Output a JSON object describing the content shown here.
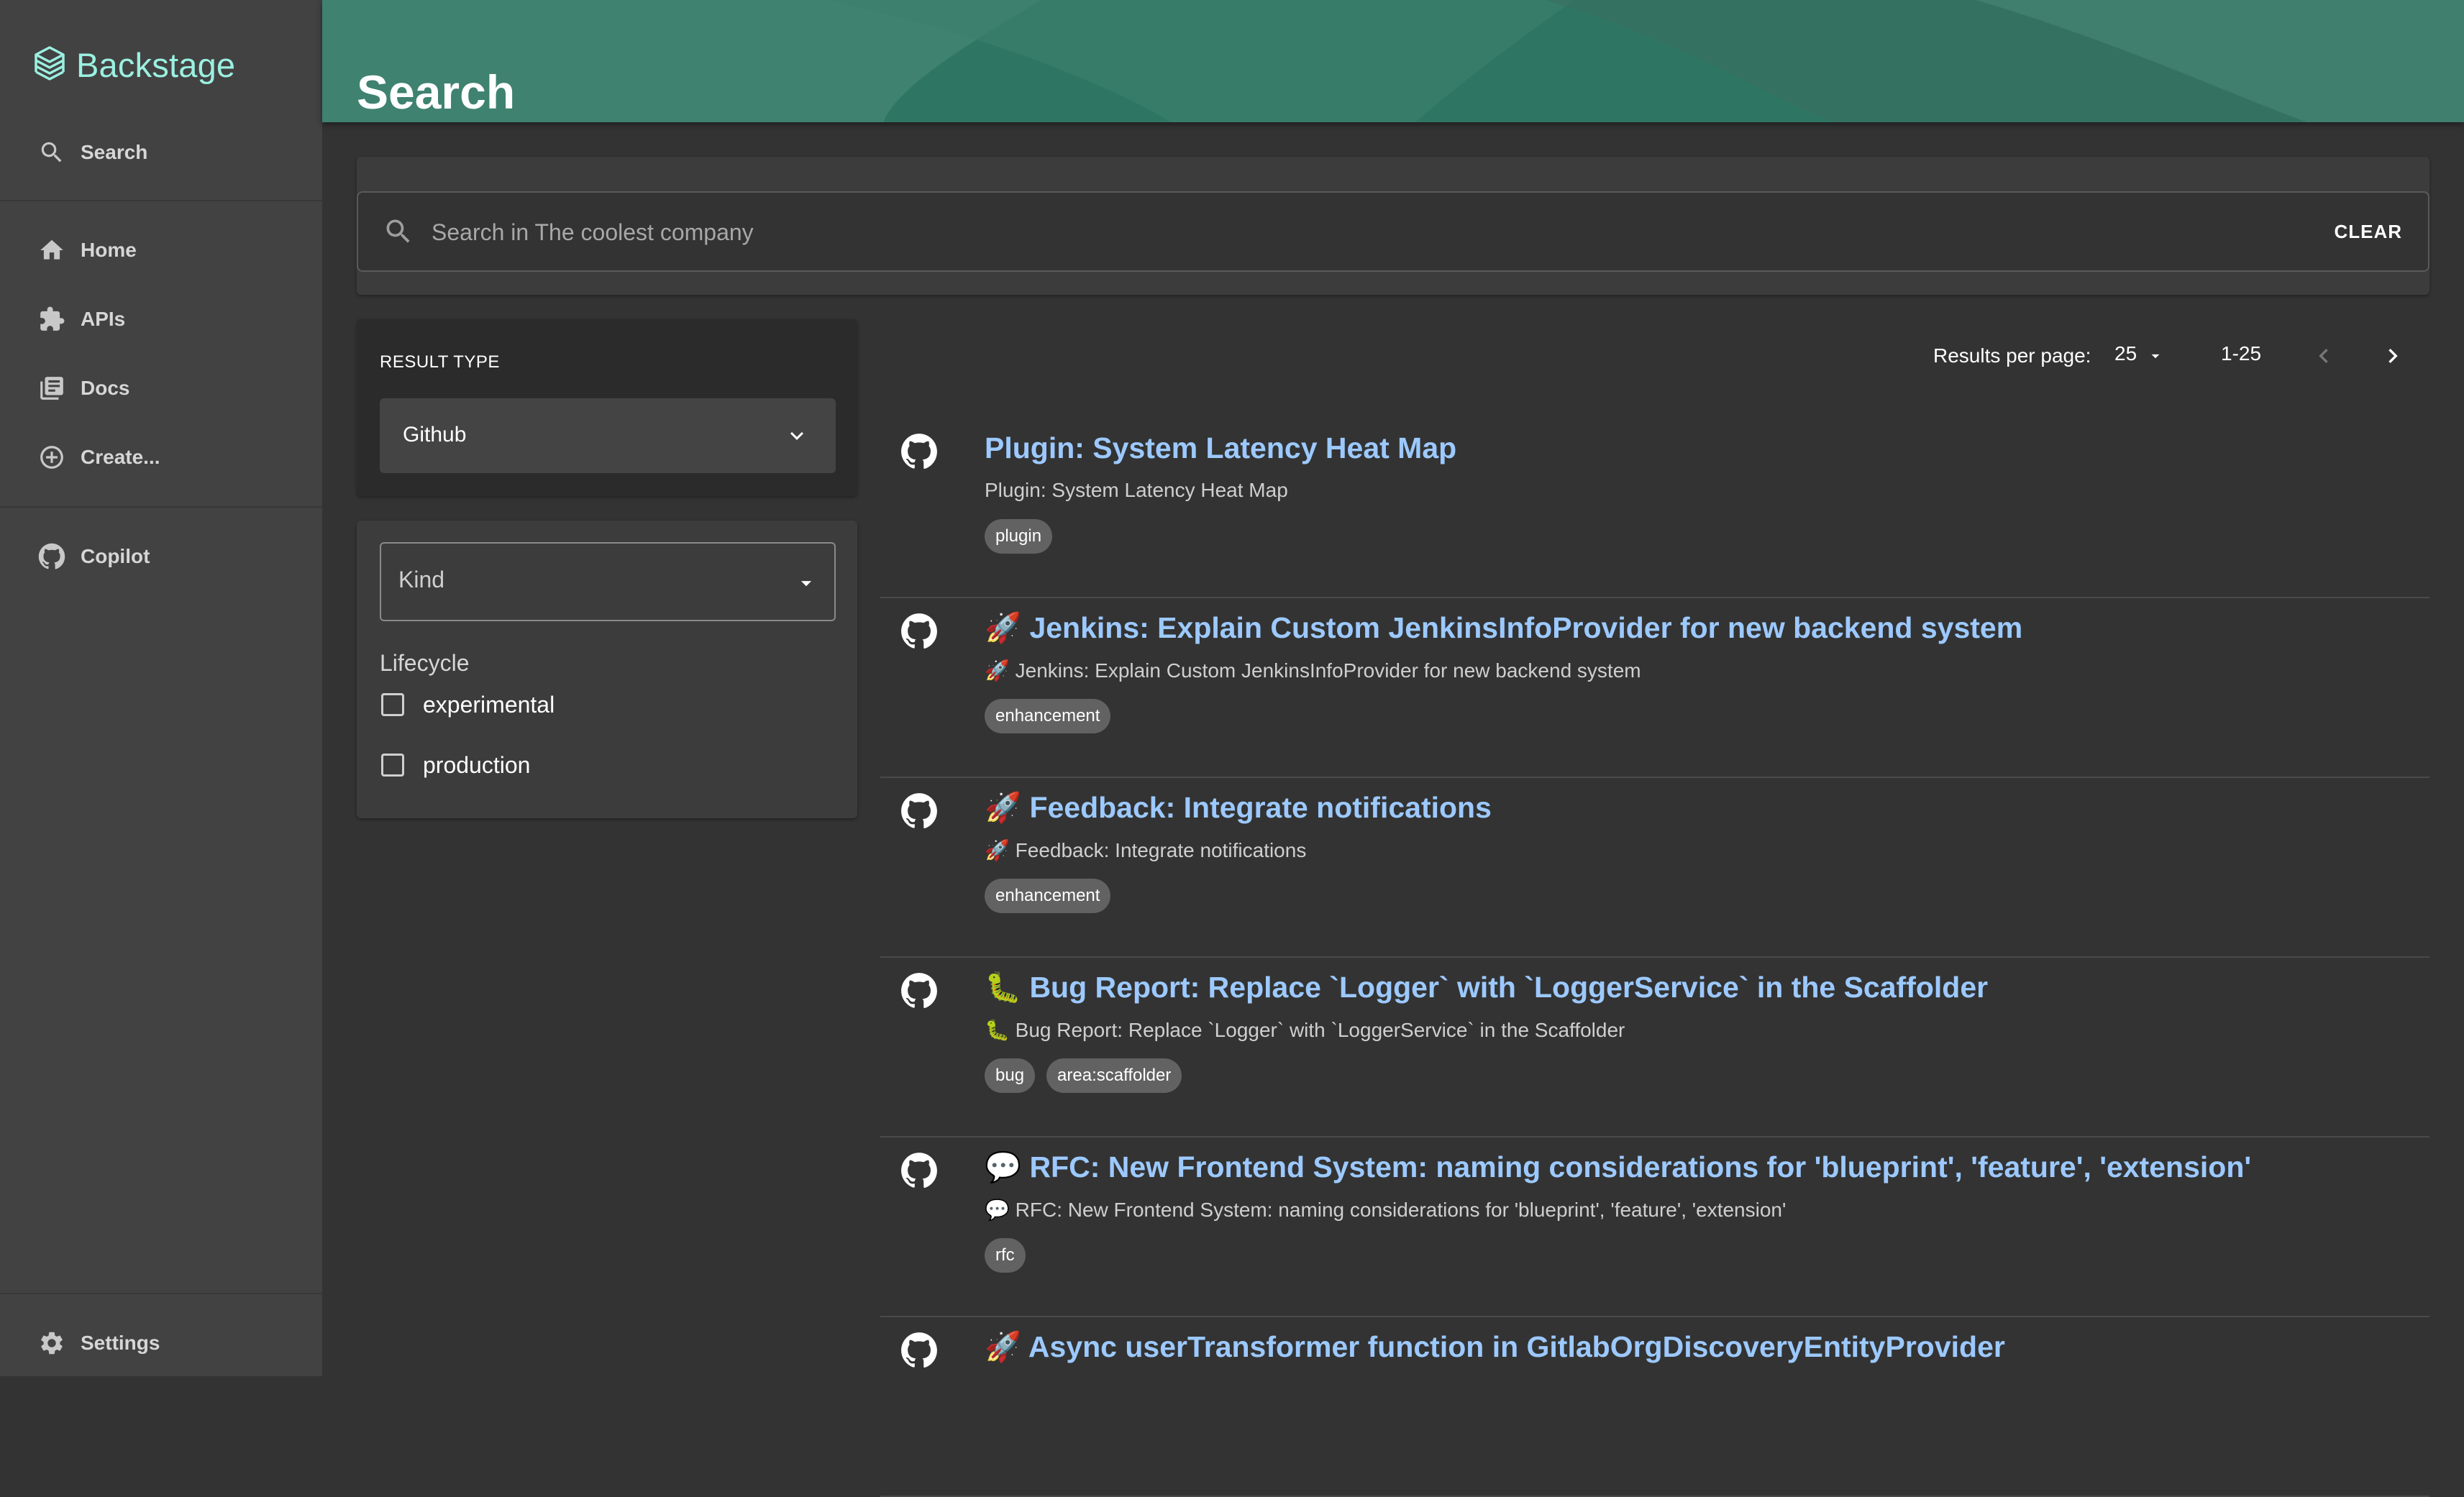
{
  "app": {
    "name": "Backstage",
    "colors": {
      "accent": "#9BF0E1",
      "link": "#9CC9FF",
      "header": "#2f7564",
      "sidebar": "#424242",
      "background": "#333333"
    }
  },
  "sidebar": {
    "search_label": "Search",
    "items": [
      {
        "label": "Home",
        "icon": "home-icon"
      },
      {
        "label": "APIs",
        "icon": "puzzle-icon"
      },
      {
        "label": "Docs",
        "icon": "library-books-icon"
      },
      {
        "label": "Create...",
        "icon": "add-circle-icon"
      }
    ],
    "copilot_label": "Copilot",
    "settings_label": "Settings"
  },
  "header": {
    "title": "Search"
  },
  "search": {
    "placeholder": "Search in The coolest company",
    "value": "",
    "clear_label": "CLEAR"
  },
  "filters": {
    "result_type_label": "RESULT TYPE",
    "result_type_value": "Github",
    "kind_label": "Kind",
    "lifecycle_label": "Lifecycle",
    "lifecycle_options": [
      "experimental",
      "production"
    ]
  },
  "pagination": {
    "results_per_page_label": "Results per page:",
    "results_per_page": "25",
    "range": "1-25"
  },
  "results": [
    {
      "title": "Plugin: System Latency Heat Map",
      "subtitle": "Plugin: System Latency Heat Map",
      "tags": [
        "plugin"
      ],
      "icon": "github-icon"
    },
    {
      "title": "🚀 Jenkins: Explain Custom JenkinsInfoProvider for new backend system",
      "subtitle": "🚀 Jenkins: Explain Custom JenkinsInfoProvider for new backend system",
      "tags": [
        "enhancement"
      ],
      "icon": "github-icon"
    },
    {
      "title": "🚀 Feedback: Integrate notifications",
      "subtitle": "🚀 Feedback: Integrate notifications",
      "tags": [
        "enhancement"
      ],
      "icon": "github-icon"
    },
    {
      "title": "🐛 Bug Report: Replace `Logger` with `LoggerService` in the Scaffolder",
      "subtitle": "🐛 Bug Report: Replace `Logger` with `LoggerService` in the Scaffolder",
      "tags": [
        "bug",
        "area:scaffolder"
      ],
      "icon": "github-icon"
    },
    {
      "title": "💬 RFC: New Frontend System: naming considerations for 'blueprint', 'feature', 'extension'",
      "subtitle": "💬 RFC: New Frontend System: naming considerations for 'blueprint', 'feature', 'extension'",
      "tags": [
        "rfc"
      ],
      "icon": "github-icon"
    },
    {
      "title": "🚀 Async userTransformer function in GitlabOrgDiscoveryEntityProvider",
      "subtitle": "",
      "tags": [],
      "icon": "github-icon"
    }
  ]
}
